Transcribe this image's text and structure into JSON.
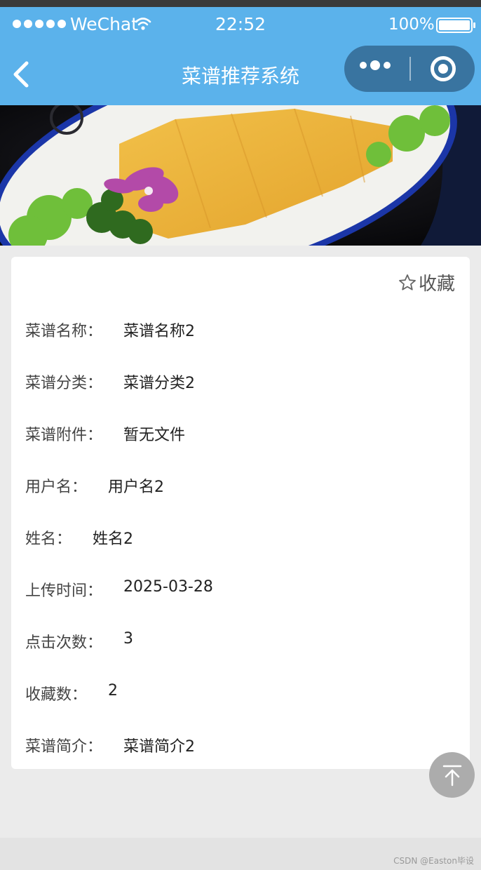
{
  "status_bar": {
    "carrier": "WeChat",
    "time": "22:52",
    "battery": "100%",
    "signal_icon": "signal-dots-icon",
    "wifi_icon": "wifi-icon",
    "battery_icon": "battery-icon"
  },
  "nav": {
    "title": "菜谱推荐系统",
    "back_icon": "chevron-left-icon",
    "more_icon": "more-dots-icon",
    "close_icon": "close-circle-icon",
    "bg_color": "#5bb2eb"
  },
  "banner": {
    "image": "fried-food-dish-photo"
  },
  "detail": {
    "favorite_label": "收藏",
    "favorite_icon": "star-outline-icon",
    "fields": [
      {
        "label": "菜谱名称：",
        "value": "菜谱名称2"
      },
      {
        "label": "菜谱分类：",
        "value": "菜谱分类2"
      },
      {
        "label": "菜谱附件：",
        "value": "暂无文件"
      },
      {
        "label": "用户名：",
        "value": "用户名2"
      },
      {
        "label": "姓名：",
        "value": "姓名2"
      },
      {
        "label": "上传时间：",
        "value": "2025-03-28"
      },
      {
        "label": "点击次数：",
        "value": "3"
      },
      {
        "label": "收藏数：",
        "value": "2"
      },
      {
        "label": "菜谱简介：",
        "value": "菜谱简介2"
      }
    ]
  },
  "back_to_top_icon": "arrow-up-to-top-icon",
  "watermark": "CSDN @Easton毕设"
}
